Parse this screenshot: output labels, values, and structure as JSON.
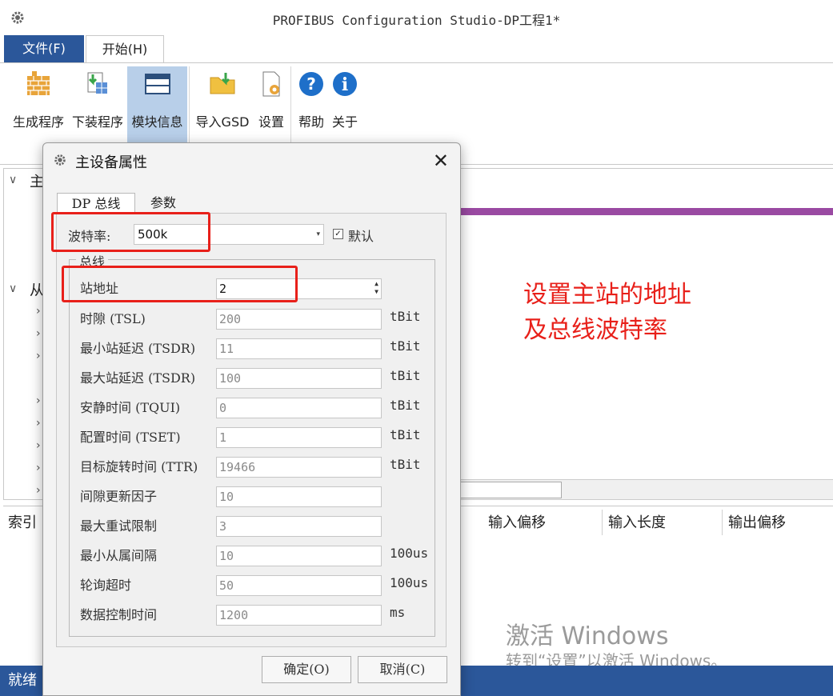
{
  "window": {
    "title": "PROFIBUS Configuration Studio-DP工程1*",
    "icon": "gear-icon"
  },
  "menu": {
    "file": "文件(F)",
    "start": "开始(H)"
  },
  "ribbon": {
    "buttons": [
      {
        "label": "生成程序",
        "icon": "bricks-icon"
      },
      {
        "label": "下装程序",
        "icon": "download-grid-icon"
      },
      {
        "label": "模块信息",
        "icon": "module-window-icon",
        "active": true
      },
      {
        "label": "导入GSD",
        "icon": "import-folder-icon"
      },
      {
        "label": "设置",
        "icon": "settings-doc-icon"
      },
      {
        "label": "帮助",
        "icon": "help-icon"
      },
      {
        "label": "关于",
        "icon": "info-icon"
      }
    ]
  },
  "tree": {
    "master_partial": "主",
    "slave_partial": "从"
  },
  "table": {
    "columns": [
      "索引",
      "输入偏移",
      "输入长度",
      "输出偏移"
    ]
  },
  "status": {
    "text": "就绪"
  },
  "watermark": {
    "line1": "激活 Windows",
    "line2": "转到“设置”以激活 Windows。"
  },
  "dialog": {
    "title": "主设备属性",
    "tabs": [
      "DP 总线",
      "参数"
    ],
    "baud_label": "波特率:",
    "baud_value": "500k",
    "default_label": "默认",
    "default_checked": true,
    "group_title": "总线",
    "station_label": "站地址",
    "station_value": "2",
    "fields": [
      {
        "label": "时隙 (TSL)",
        "value": "200",
        "unit": "tBit"
      },
      {
        "label": "最小站延迟 (TSDR)",
        "value": "11",
        "unit": "tBit"
      },
      {
        "label": "最大站延迟 (TSDR)",
        "value": "100",
        "unit": "tBit"
      },
      {
        "label": "安静时间 (TQUI)",
        "value": "0",
        "unit": "tBit"
      },
      {
        "label": "配置时间 (TSET)",
        "value": "1",
        "unit": "tBit"
      },
      {
        "label": "目标旋转时间 (TTR)",
        "value": "19466",
        "unit": "tBit"
      },
      {
        "label": "间隙更新因子",
        "value": "10",
        "unit": ""
      },
      {
        "label": "最大重试限制",
        "value": "3",
        "unit": ""
      },
      {
        "label": "最小从属间隔",
        "value": "10",
        "unit": "100us"
      },
      {
        "label": "轮询超时",
        "value": "50",
        "unit": "100us"
      },
      {
        "label": "数据控制时间",
        "value": "1200",
        "unit": "ms"
      }
    ],
    "ok": "确定(O)",
    "cancel": "取消(C)"
  },
  "annotation": {
    "line1": "设置主站的地址",
    "line2": "及总线波特率",
    "color": "#e8201a"
  }
}
